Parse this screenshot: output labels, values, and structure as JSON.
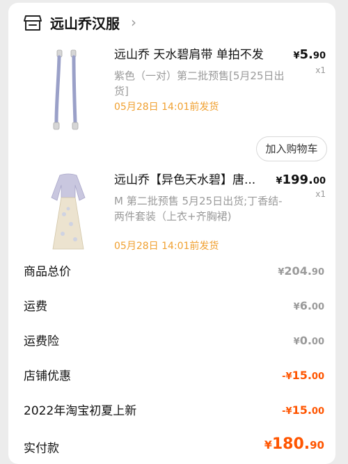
{
  "store": {
    "name": "远山乔汉服",
    "chevron": "›"
  },
  "products": [
    {
      "title": "远山乔 天水碧肩带 单拍不发",
      "spec": "紫色（一对）第二批预售[5月25日出货]",
      "ship": "05月28日 14:01前发货",
      "price_symbol": "¥",
      "price_int": "5.",
      "price_dec": "90",
      "qty": "x1"
    },
    {
      "title": "远山乔【异色天水碧】唐...",
      "spec": "M 第二批预售 5月25日出货;丁香结-两件套装（上衣+齐胸裙)",
      "ship": "05月28日 14:01前发货",
      "price_symbol": "¥",
      "price_int": "199.",
      "price_dec": "00",
      "qty": "x1"
    }
  ],
  "cart_button": "加入购物车",
  "summary": {
    "goods_total": {
      "label": "商品总价",
      "sym": "¥",
      "int": "204.",
      "dec": "90"
    },
    "shipping": {
      "label": "运费",
      "sym": "¥",
      "int": "6.",
      "dec": "00"
    },
    "shipping_insurance": {
      "label": "运费险",
      "sym": "¥",
      "int": "0.",
      "dec": "00"
    },
    "store_discount": {
      "label": "店铺优惠",
      "sym": "-¥",
      "int": "15.",
      "dec": "00"
    },
    "event_discount": {
      "label": "2022年淘宝初夏上新",
      "sym": "-¥",
      "int": "15.",
      "dec": "00"
    },
    "paid": {
      "label": "实付款",
      "sym": "¥",
      "int": "180.",
      "dec": "90"
    }
  },
  "colors": {
    "accent_orange": "#ff5500",
    "ship_orange": "#f0a030",
    "muted_gray": "#9a9a9a"
  },
  "icons": [
    "store-icon",
    "chevron-right-icon",
    "strap-thumbnail",
    "dress-thumbnail"
  ]
}
